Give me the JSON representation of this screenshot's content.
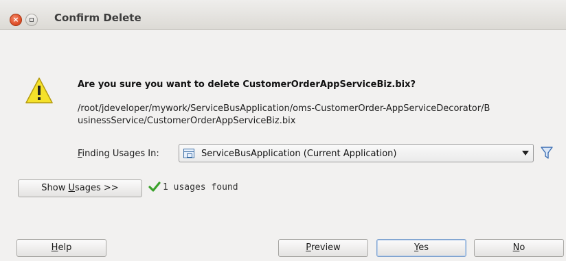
{
  "window": {
    "title": "Confirm Delete",
    "close_glyph": "×",
    "controls": [
      "close-icon",
      "maximize-icon"
    ]
  },
  "dialog": {
    "icon": "warning-icon",
    "question": "Are you sure you want to delete CustomerOrderAppServiceBiz.bix?",
    "path": "/root/jdeveloper/mywork/ServiceBusApplication/oms-CustomerOrder-AppServiceDecorator/B\nusinessService/CustomerOrderAppServiceBiz.bix",
    "finding_label_mnemonic": "F",
    "finding_label_rest": "inding Usages In:",
    "finding_select": {
      "icon": "application-icon",
      "value": "ServiceBusApplication (Current Application)"
    },
    "filter_icon": "filter-icon"
  },
  "usages": {
    "show_button_prefix": "Show ",
    "show_button_mnemonic": "U",
    "show_button_suffix": "sages >>",
    "status_icon": "checkmark-icon",
    "status_text": "1 usages found"
  },
  "buttons": {
    "help_mnemonic": "H",
    "help_rest": "elp",
    "preview_mnemonic": "P",
    "preview_rest": "review",
    "yes_mnemonic": "Y",
    "yes_rest": "es",
    "no_mnemonic": "N",
    "no_rest": "o"
  },
  "colors": {
    "close_button": "#e0502a",
    "warning_fill": "#f5e12a",
    "check_green": "#3aa12a",
    "filter_blue": "#3d6fb3"
  }
}
